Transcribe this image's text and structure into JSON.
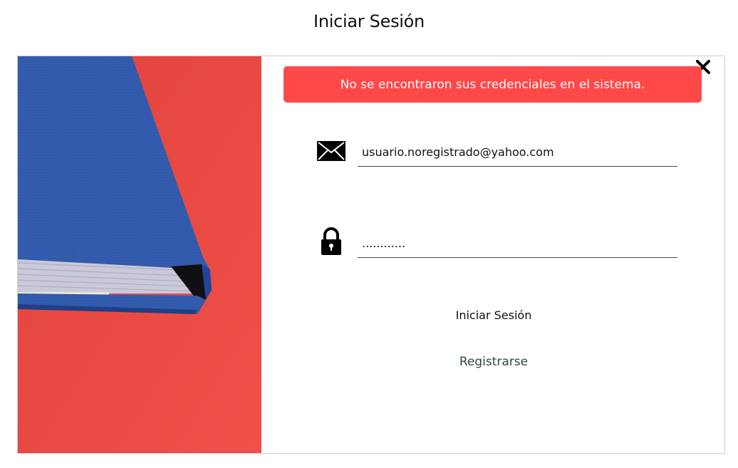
{
  "page": {
    "title": "Iniciar Sesión"
  },
  "modal": {
    "alert": {
      "message": "No se encontraron sus credenciales en el sistema.",
      "color": "#ff4848"
    },
    "close_icon": "close-icon",
    "email": {
      "icon": "envelope-icon",
      "value": "usuario.noregistrado@yahoo.com"
    },
    "password": {
      "icon": "lock-icon",
      "value": "............"
    },
    "login_label": "Iniciar Sesión",
    "register_label": "Registrarse"
  },
  "colors": {
    "accent_red": "#ff4848",
    "book_blue": "#2f56a8",
    "link_green": "#2e4a45"
  }
}
